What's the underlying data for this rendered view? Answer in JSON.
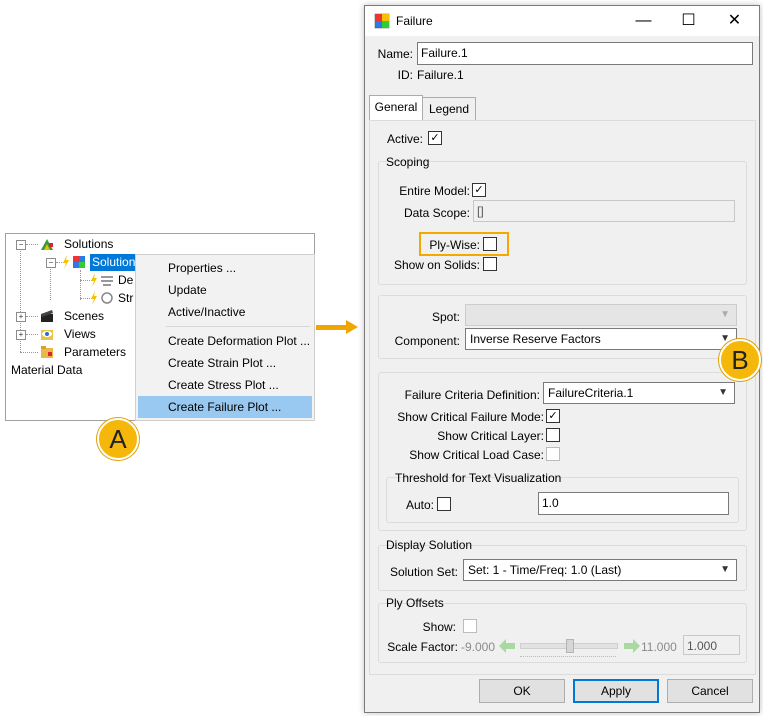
{
  "tree": {
    "items": [
      {
        "label": "Solutions"
      },
      {
        "label": "Solution"
      },
      {
        "label": "De"
      },
      {
        "label": "Str"
      },
      {
        "label": "Scenes"
      },
      {
        "label": "Views"
      },
      {
        "label": "Parameters"
      },
      {
        "label": "Material Data"
      }
    ]
  },
  "context_menu": {
    "items": [
      "Properties ...",
      "Update",
      "Active/Inactive",
      "Create Deformation Plot ...",
      "Create Strain Plot ...",
      "Create Stress Plot ...",
      "Create Failure Plot ..."
    ],
    "highlighted": "Create Failure Plot ..."
  },
  "badges": {
    "a": "A",
    "b": "B"
  },
  "colors": {
    "badge": "#f5b80a",
    "arrow": "#f0a500",
    "highlight": "#f5a800",
    "selection": "#0078d7",
    "menu_highlight": "#99c9f0"
  },
  "dialog": {
    "title": "Failure",
    "window_buttons": {
      "minimize": "—",
      "maximize": "☐",
      "close": "✕"
    },
    "name_label": "Name:",
    "name_value": "Failure.1",
    "id_label": "ID:",
    "id_value": "Failure.1",
    "tabs": [
      {
        "label": "General"
      },
      {
        "label": "Legend"
      }
    ],
    "active_label": "Active:",
    "scoping": {
      "title": "Scoping",
      "entire_model_label": "Entire Model:",
      "data_scope_label": "Data Scope:",
      "data_scope_value": "[]",
      "ply_wise_label": "Ply-Wise:",
      "show_on_solids_label": "Show on Solids:"
    },
    "spot_label": "Spot:",
    "component_label": "Component:",
    "component_value": "Inverse Reserve Factors",
    "criteria": {
      "definition_label": "Failure Criteria Definition:",
      "definition_value": "FailureCriteria.1",
      "show_critical_mode_label": "Show Critical Failure Mode:",
      "show_critical_layer_label": "Show Critical Layer:",
      "show_critical_load_case_label": "Show Critical Load Case:"
    },
    "threshold": {
      "title": "Threshold for Text Visualization",
      "auto_label": "Auto:",
      "value": "1.0"
    },
    "display_solution": {
      "title": "Display Solution",
      "solution_set_label": "Solution Set:",
      "solution_set_value": "Set: 1 - Time/Freq: 1.0 (Last)"
    },
    "ply_offsets": {
      "title": "Ply Offsets",
      "show_label": "Show:",
      "scale_factor_label": "Scale Factor:",
      "min": "-9.000",
      "max": "11.000",
      "value": "1.000",
      "slider_fraction": 0.5
    },
    "buttons": {
      "ok": "OK",
      "apply": "Apply",
      "cancel": "Cancel"
    }
  }
}
